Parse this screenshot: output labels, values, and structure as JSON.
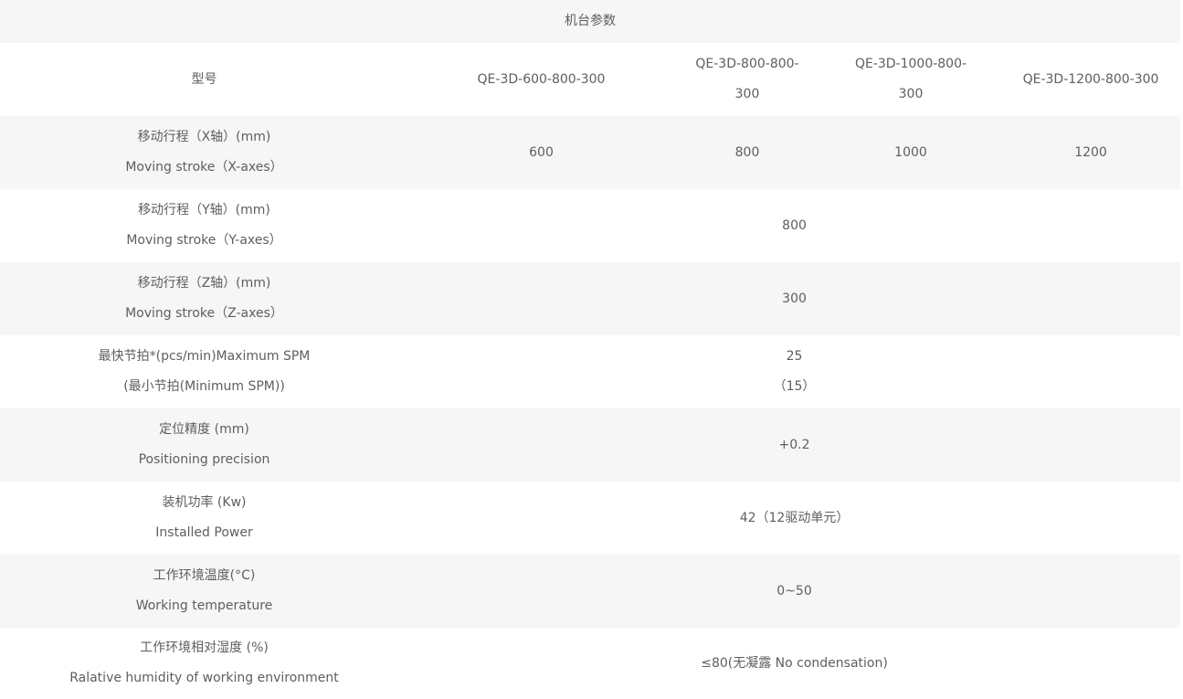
{
  "table": {
    "title": "机台参数",
    "model_label": "型号",
    "models": [
      "QE-3D-600-800-300",
      "QE-3D-800-800-300",
      "QE-3D-1000-800-300",
      "QE-3D-1200-800-300"
    ],
    "rows": [
      {
        "label_cn": "移动行程（X轴）(mm)",
        "label_en": "Moving stroke（X-axes）",
        "values": [
          "600",
          "800",
          "1000",
          "1200"
        ]
      },
      {
        "label_cn": "移动行程（Y轴）(mm)",
        "label_en": "Moving stroke（Y-axes）",
        "value": "800"
      },
      {
        "label_cn": "移动行程（Z轴）(mm)",
        "label_en": "Moving stroke（Z-axes）",
        "value": "300"
      },
      {
        "label_cn": "最快节拍*(pcs/min)Maximum SPM",
        "label_en": "(最小节拍(Minimum SPM))",
        "value": "25",
        "value_line2": "（15）"
      },
      {
        "label_cn": "定位精度 (mm)",
        "label_en": "Positioning precision",
        "value": "+0.2"
      },
      {
        "label_cn": "装机功率 (Kw)",
        "label_en": "Installed Power",
        "value": "42（12驱动单元）"
      },
      {
        "label_cn": "工作环境温度(°C)",
        "label_en": "Working temperature",
        "value": "0~50"
      },
      {
        "label_cn": "工作环境相对湿度 (%)",
        "label_en": "Ralative humidity of working environment",
        "value": "≤80(无凝露 No condensation)"
      }
    ]
  }
}
